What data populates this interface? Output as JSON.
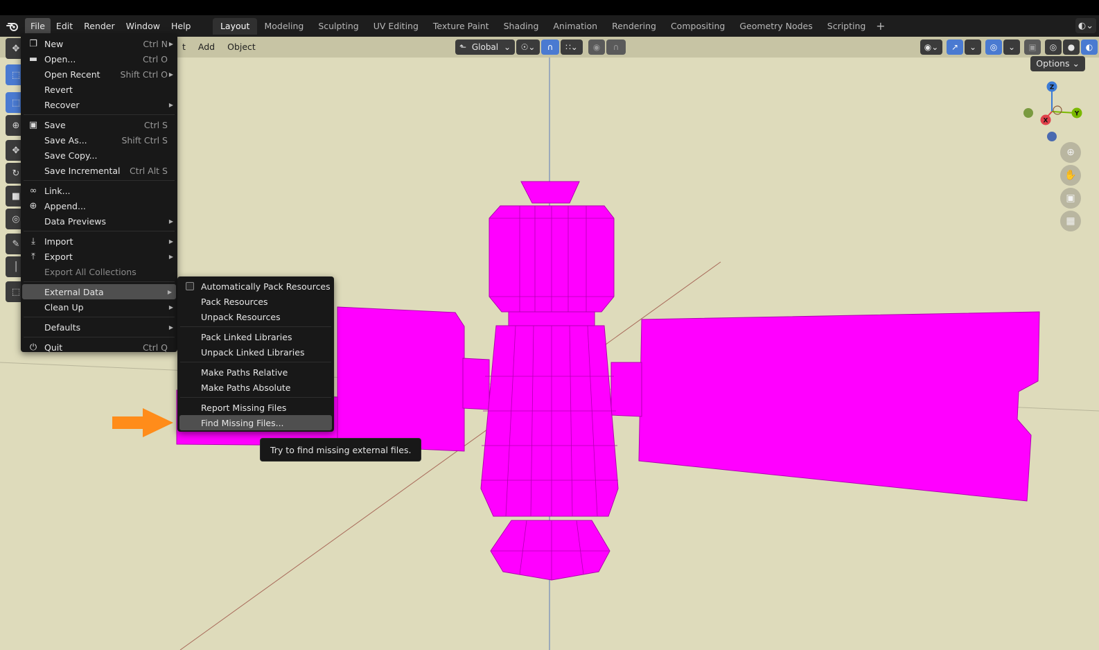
{
  "menubar": {
    "items": [
      "File",
      "Edit",
      "Render",
      "Window",
      "Help"
    ],
    "workspaces": [
      "Layout",
      "Modeling",
      "Sculpting",
      "UV Editing",
      "Texture Paint",
      "Shading",
      "Animation",
      "Rendering",
      "Compositing",
      "Geometry Nodes",
      "Scripting"
    ],
    "active_workspace": "Layout",
    "add_workspace": "+"
  },
  "viewport_header": {
    "menu_partial": "t",
    "add_label": "Add",
    "object_label": "Object",
    "orientation": "Global",
    "options_label": "Options"
  },
  "gizmo": {
    "z": "Z",
    "x": "X",
    "y": "Y"
  },
  "file_menu": {
    "items": [
      {
        "label": "New",
        "shortcut": "Ctrl N",
        "icon": "new-file-icon",
        "submenu": true
      },
      {
        "label": "Open...",
        "shortcut": "Ctrl O",
        "icon": "folder-icon"
      },
      {
        "label": "Open Recent",
        "shortcut": "Shift Ctrl O",
        "submenu": true
      },
      {
        "label": "Revert"
      },
      {
        "label": "Recover",
        "submenu": true
      },
      {
        "label": "Save",
        "shortcut": "Ctrl S",
        "icon": "save-icon"
      },
      {
        "label": "Save As...",
        "shortcut": "Shift Ctrl S"
      },
      {
        "label": "Save Copy..."
      },
      {
        "label": "Save Incremental",
        "shortcut": "Ctrl Alt S"
      },
      {
        "label": "Link...",
        "icon": "link-icon"
      },
      {
        "label": "Append...",
        "icon": "append-icon"
      },
      {
        "label": "Data Previews",
        "submenu": true
      },
      {
        "label": "Import",
        "icon": "import-icon",
        "submenu": true
      },
      {
        "label": "Export",
        "icon": "export-icon",
        "submenu": true
      },
      {
        "label": "Export All Collections",
        "disabled": true
      },
      {
        "label": "External Data",
        "submenu": true,
        "highlighted": true
      },
      {
        "label": "Clean Up",
        "submenu": true
      },
      {
        "label": "Defaults",
        "submenu": true
      },
      {
        "label": "Quit",
        "shortcut": "Ctrl Q",
        "icon": "power-icon"
      }
    ]
  },
  "external_data_menu": {
    "items": [
      "Automatically Pack Resources",
      "Pack Resources",
      "Unpack Resources",
      "Pack Linked Libraries",
      "Unpack Linked Libraries",
      "Make Paths Relative",
      "Make Paths Absolute",
      "Report Missing Files",
      "Find Missing Files..."
    ],
    "highlighted": "Find Missing Files..."
  },
  "tooltip": {
    "text": "Try to find missing external files."
  },
  "colors": {
    "viewport_bg": "#dedbbb",
    "model": "#ff00ff",
    "menu_bg": "#181818",
    "highlight": "#4f4f4f",
    "arrow": "#ff8c1a",
    "accent_blue": "#4a7ad1"
  }
}
